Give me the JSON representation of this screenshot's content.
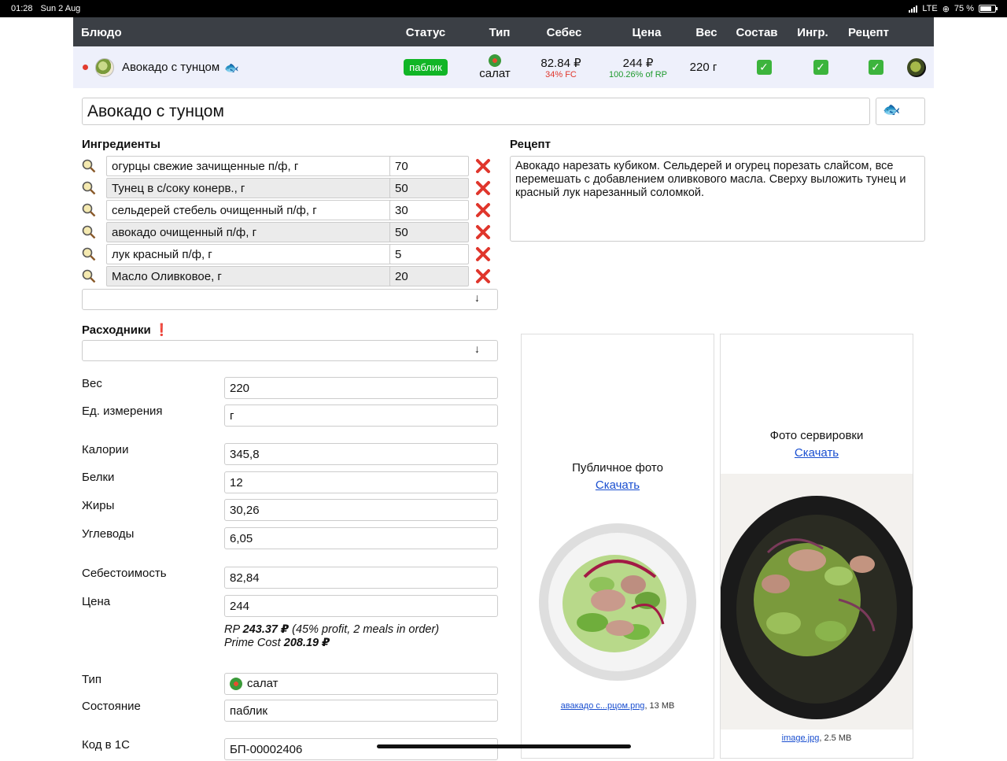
{
  "status_bar": {
    "time": "01:28",
    "date": "Sun 2 Aug",
    "network": "LTE",
    "battery": "75 %",
    "battery_level": 0.75
  },
  "table": {
    "headers": [
      "Блюдо",
      "Статус",
      "Тип",
      "Себес",
      "Цена",
      "Вес",
      "Состав",
      "Ингр.",
      "Рецепт"
    ],
    "row": {
      "name": "Авокадо с тунцом",
      "name_emoji": "🐟",
      "status": "паблик",
      "type": "салат",
      "cost": "82.84 ₽",
      "cost_fc": "34% FC",
      "price": "244 ₽",
      "price_rp": "100.26% of RP",
      "weight": "220 г",
      "composition_check": "✓",
      "ingredients_check": "✓",
      "recipe_check": "✓"
    }
  },
  "dish": {
    "title": "Авокадо с тунцом",
    "emoji": "🐟"
  },
  "ingredients": {
    "title": "Ингредиенты",
    "items": [
      {
        "name": "огурцы свежие зачищенные п/ф, г",
        "qty": "70"
      },
      {
        "name": "Тунец в с/соку конерв., г",
        "qty": "50"
      },
      {
        "name": "сельдерей стебель очищенный п/ф, г",
        "qty": "30"
      },
      {
        "name": "авокадо очищенный п/ф, г",
        "qty": "50"
      },
      {
        "name": "лук красный п/ф, г",
        "qty": "5"
      },
      {
        "name": "Масло Оливковое, г",
        "qty": "20"
      }
    ],
    "arrow_icon": "arrow-down-icon"
  },
  "recipe": {
    "title": "Рецепт",
    "text": "Авокадо нарезать кубиком. Сельдерей и огурец порезать слайсом, все перемешать с добавлением оливкового масла. Сверху выложить тунец и красный лук нарезанный соломкой."
  },
  "consumables": {
    "title": "Расходники",
    "alert": "❗"
  },
  "fields": {
    "weight": {
      "label": "Вес",
      "value": "220"
    },
    "unit": {
      "label": "Ед. измерения",
      "value": "г"
    },
    "calories": {
      "label": "Калории",
      "value": "345,8"
    },
    "protein": {
      "label": "Белки",
      "value": "12"
    },
    "fat": {
      "label": "Жиры",
      "value": "30,26"
    },
    "carbs": {
      "label": "Углеводы",
      "value": "6,05"
    },
    "cost": {
      "label": "Себестоимость",
      "value": "82,84"
    },
    "price": {
      "label": "Цена",
      "value": "244"
    },
    "type": {
      "label": "Тип",
      "value": "салат"
    },
    "state": {
      "label": "Состояние",
      "value": "паблик"
    },
    "code1c": {
      "label": "Код в 1С",
      "value": "БП-00002406"
    }
  },
  "price_note": {
    "rp_prefix": "RP ",
    "rp_value": "243.37 ₽",
    "rp_suffix": " (45% profit, 2 meals in order)",
    "prime_prefix": "Prime Cost ",
    "prime_value": "208.19 ₽"
  },
  "photos": {
    "public": {
      "caption": "Публичное фото",
      "download": "Скачать",
      "file": "авакадо с...рцом.png",
      "size": ", 13 MB"
    },
    "serving": {
      "caption": "Фото сервировки",
      "download": "Скачать",
      "file": "image.jpg",
      "size": ", 2.5 MB"
    }
  },
  "colors": {
    "header_bg": "#3b3f45",
    "row_bg": "#eef0fb",
    "public_badge": "#11b526",
    "delete_red": "#e0362c",
    "link": "#1a4fd0"
  }
}
